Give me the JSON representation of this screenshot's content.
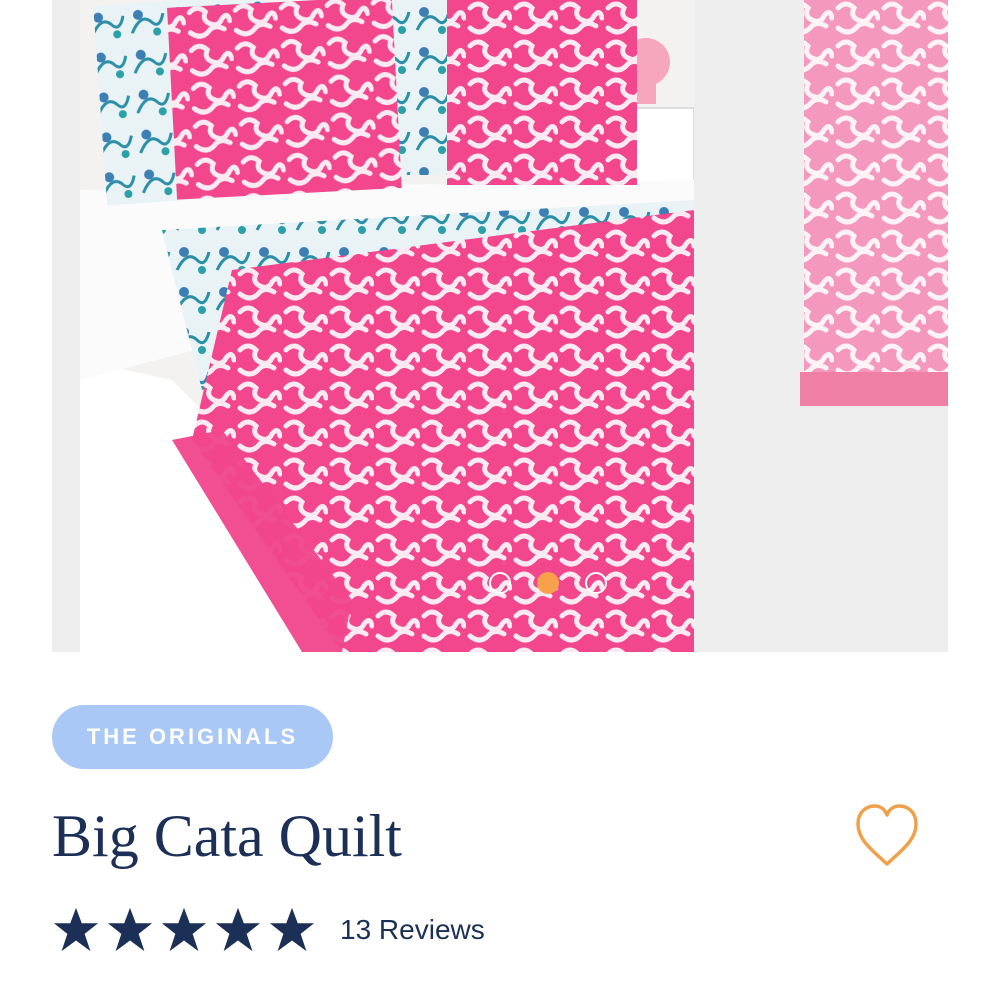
{
  "gallery": {
    "slides": [
      "slide-1",
      "slide-2",
      "slide-3"
    ],
    "active_index": 1,
    "dot_active_color": "#f7a24a"
  },
  "product": {
    "collection_badge": "THE ORIGINALS",
    "title": "Big Cata Quilt",
    "rating": 5,
    "reviews_label": "13 Reviews",
    "favorite_icon": "heart-outline-icon"
  },
  "colors": {
    "brand_navy": "#1c2f57",
    "badge_bg": "#a9c8f6",
    "heart_orange": "#f0a04a",
    "quilt_pink": "#f0468c"
  }
}
